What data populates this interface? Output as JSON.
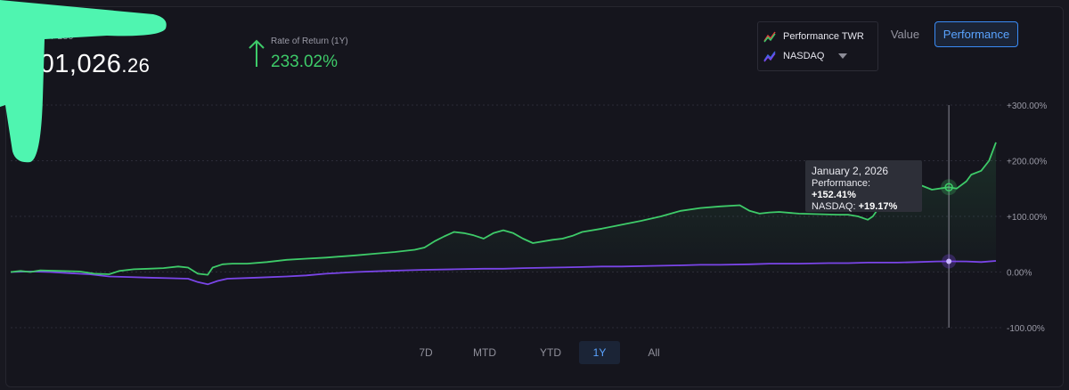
{
  "header": {
    "portfolio_label": "/ 180",
    "portfolio_value_main": "101,026",
    "portfolio_value_cents": ".26",
    "ror_label": "Rate of Return (1Y)",
    "ror_value": "233.02%"
  },
  "legend": {
    "items": [
      {
        "label": "Performance TWR",
        "color": "#3ecb69",
        "icon": "line-chart-icon"
      },
      {
        "label": "NASDAQ",
        "color": "#7a45e8",
        "icon": "line-chart-icon"
      }
    ]
  },
  "toggles": {
    "value_label": "Value",
    "performance_label": "Performance",
    "active": "Performance"
  },
  "ranges": {
    "items": [
      {
        "label": "7D",
        "active": false
      },
      {
        "label": "MTD",
        "active": false
      },
      {
        "label": "YTD",
        "active": false
      },
      {
        "label": "1Y",
        "active": true
      },
      {
        "label": "All",
        "active": false
      }
    ]
  },
  "tooltip": {
    "date": "January 2, 2026",
    "perf_label": "Performance: ",
    "perf_value": "+152.41%",
    "nasdaq_label": "NASDAQ: ",
    "nasdaq_value": "+19.17%"
  },
  "colors": {
    "performance": "#3ecb69",
    "nasdaq": "#7a45e8",
    "accent": "#3a8bf5",
    "redaction": "#4ff5b0"
  },
  "chart_data": {
    "type": "line",
    "x_range": [
      0,
      1
    ],
    "ylim": [
      -100,
      300
    ],
    "y_ticks": [
      -100,
      0,
      100,
      200,
      300
    ],
    "y_tick_labels": [
      "-100.00%",
      "0.00%",
      "+100.00%",
      "+200.00%",
      "+300.00%"
    ],
    "grid": true,
    "legend_position": "top-right",
    "tooltip_x": 0.9522,
    "series": [
      {
        "name": "Performance TWR",
        "color": "#3ecb69",
        "x": [
          0,
          0.01,
          0.02,
          0.03,
          0.05,
          0.07,
          0.085,
          0.1,
          0.11,
          0.125,
          0.14,
          0.155,
          0.17,
          0.18,
          0.19,
          0.2,
          0.205,
          0.215,
          0.225,
          0.24,
          0.26,
          0.28,
          0.3,
          0.32,
          0.35,
          0.37,
          0.39,
          0.41,
          0.42,
          0.43,
          0.44,
          0.45,
          0.46,
          0.47,
          0.48,
          0.49,
          0.5,
          0.51,
          0.52,
          0.53,
          0.55,
          0.56,
          0.57,
          0.58,
          0.6,
          0.62,
          0.64,
          0.66,
          0.68,
          0.7,
          0.72,
          0.74,
          0.75,
          0.76,
          0.77,
          0.78,
          0.8,
          0.82,
          0.84,
          0.85,
          0.86,
          0.87,
          0.875,
          0.885,
          0.895,
          0.905,
          0.915,
          0.925,
          0.935,
          0.9522,
          0.96,
          0.97,
          0.975,
          0.985,
          0.993,
          1.0
        ],
        "values": [
          0,
          2,
          0,
          3,
          2,
          1,
          -3,
          -4,
          2,
          5,
          6,
          7,
          10,
          8,
          -3,
          -5,
          8,
          14,
          15,
          15,
          18,
          22,
          24,
          26,
          30,
          33,
          36,
          40,
          44,
          55,
          64,
          72,
          70,
          66,
          60,
          70,
          75,
          70,
          60,
          52,
          58,
          60,
          65,
          72,
          78,
          85,
          92,
          100,
          110,
          115,
          118,
          120,
          110,
          105,
          107,
          108,
          105,
          104,
          103,
          103,
          100,
          94,
          100,
          125,
          135,
          150,
          162,
          155,
          148,
          152.41,
          150,
          163,
          175,
          182,
          200,
          233
        ]
      },
      {
        "name": "NASDAQ",
        "color": "#7a45e8",
        "x": [
          0,
          0.02,
          0.04,
          0.06,
          0.08,
          0.1,
          0.12,
          0.14,
          0.16,
          0.18,
          0.19,
          0.2,
          0.21,
          0.22,
          0.25,
          0.28,
          0.3,
          0.32,
          0.35,
          0.38,
          0.4,
          0.42,
          0.45,
          0.48,
          0.5,
          0.52,
          0.55,
          0.58,
          0.6,
          0.62,
          0.65,
          0.68,
          0.7,
          0.72,
          0.75,
          0.77,
          0.8,
          0.83,
          0.85,
          0.87,
          0.9,
          0.92,
          0.94,
          0.9522,
          0.97,
          0.985,
          1.0
        ],
        "values": [
          0,
          1,
          0,
          -2,
          -4,
          -8,
          -9,
          -10,
          -11,
          -12,
          -18,
          -22,
          -16,
          -12,
          -10,
          -8,
          -6,
          -3,
          0,
          2,
          3,
          4,
          5,
          6,
          6,
          7,
          8,
          9,
          10,
          10,
          11,
          12,
          13,
          13,
          14,
          15,
          15,
          16,
          16,
          17,
          17,
          18,
          19,
          19.17,
          19,
          18,
          20
        ]
      }
    ]
  }
}
